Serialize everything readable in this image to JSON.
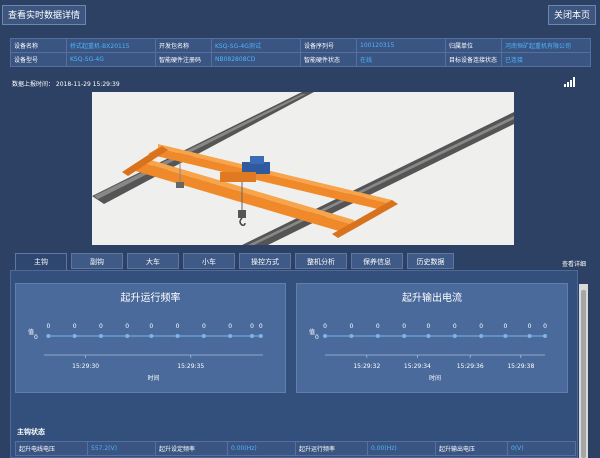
{
  "header": {
    "view_label": "查看实时数据详情",
    "close_label": "关闭本页"
  },
  "info_rows": [
    [
      {
        "label": "设备名称",
        "value": "桥式起重机-BX20115"
      },
      {
        "label": "开发包名称",
        "value": "KSQ-SG-4G测试"
      },
      {
        "label": "设备序列号",
        "value": "100120315"
      },
      {
        "label": "归属单位",
        "value": "河南恒矿起重机有限公司"
      }
    ],
    [
      {
        "label": "设备型号",
        "value": "KSQ-SG-4G"
      },
      {
        "label": "智能硬件注册码",
        "value": "NB082808CD"
      },
      {
        "label": "智能硬件状态",
        "value": "在线"
      },
      {
        "label": "目标设备连接状态",
        "value": "已连接"
      }
    ]
  ],
  "report_time": "数据上报时间：  2018-11-29 15:29:39",
  "tabs": [
    "主钩",
    "副钩",
    "大车",
    "小车",
    "操控方式",
    "整机分析",
    "保养信息",
    "历史数据"
  ],
  "detail_link": "查看详细",
  "charts": [
    {
      "title": "起升运行频率",
      "y_label": "值",
      "y_tick": "0",
      "x_label": "时间",
      "x_ticks": [
        "15:29:30",
        "15:29:35"
      ],
      "values": [
        0,
        0,
        0,
        0,
        0,
        0,
        0,
        0,
        0,
        0
      ],
      "value_label": "0"
    },
    {
      "title": "起升输出电流",
      "y_label": "值",
      "y_tick": "0",
      "x_label": "时间",
      "x_ticks": [
        "15:29:32",
        "15:29:34",
        "15:29:36",
        "15:29:38"
      ],
      "values": [
        0,
        0,
        0,
        0,
        0,
        0,
        0,
        0,
        0,
        0
      ],
      "value_label": "0"
    }
  ],
  "section": {
    "title": "主钩状态",
    "rows": [
      [
        {
          "label": "起升电线电压",
          "value": "557.2(V)"
        },
        {
          "label": "起升设定频率",
          "value": "0.00(Hz)"
        },
        {
          "label": "起升运行频率",
          "value": "0.00(Hz)"
        },
        {
          "label": "起升输出电压",
          "value": "0(V)"
        }
      ]
    ]
  },
  "colors": {
    "background": "#2c4164",
    "value_blue": "#4db4ff",
    "card": "#4a6a9c",
    "crane_orange": "#f0892a"
  }
}
